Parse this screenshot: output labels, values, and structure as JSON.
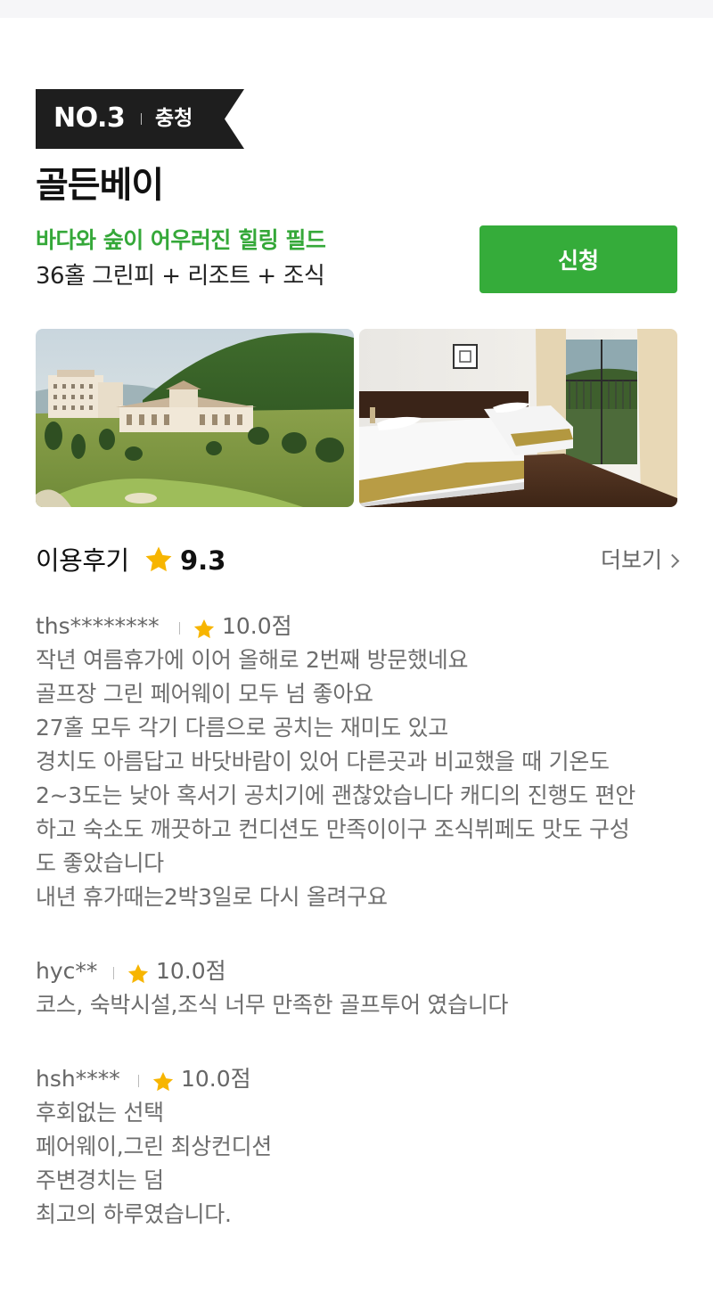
{
  "badge": {
    "rank": "NO.3",
    "region": "충청"
  },
  "product": {
    "title": "골든베이",
    "subtitle": "바다와 숲이 어우러진 힐링 필드",
    "description": "36홀 그린피 + 리조트 + 조식",
    "apply_label": "신청"
  },
  "colors": {
    "accent": "#35ac3a",
    "badge_bg": "#1e1e1e",
    "star": "#f7b500"
  },
  "reviews_header": {
    "title": "이용후기",
    "score": "9.3",
    "more_label": "더보기",
    "star_icon": "star-icon",
    "more_icon": "chevron-right-icon"
  },
  "reviews": [
    {
      "user": "ths********",
      "score": "10.0점",
      "lines": [
        "작년 여름휴가에 이어 올해로 2번째 방문했네요",
        "골프장 그린 페어웨이 모두 넘 좋아요",
        "27홀 모두 각기 다름으로 공치는 재미도 있고",
        "경치도 아름답고 바닷바람이 있어 다른곳과 비교했을 때 기온도",
        "2~3도는 낮아 혹서기 공치기에 괜찮았습니다 캐디의 진행도 편안",
        "하고 숙소도 깨끗하고 컨디션도 만족이이구 조식뷔페도 맛도 구성",
        "도 좋았습니다",
        "내년 휴가때는2박3일로 다시 올려구요"
      ]
    },
    {
      "user": "hyc**",
      "score": "10.0점",
      "lines": [
        "코스, 숙박시설,조식 너무 만족한 골프투어 였습니다"
      ]
    },
    {
      "user": "hsh****",
      "score": "10.0점",
      "lines": [
        "후회없는 선택",
        "페어웨이,그린 최상컨디션",
        "주변경치는 덤",
        "최고의 하루였습니다."
      ]
    }
  ]
}
